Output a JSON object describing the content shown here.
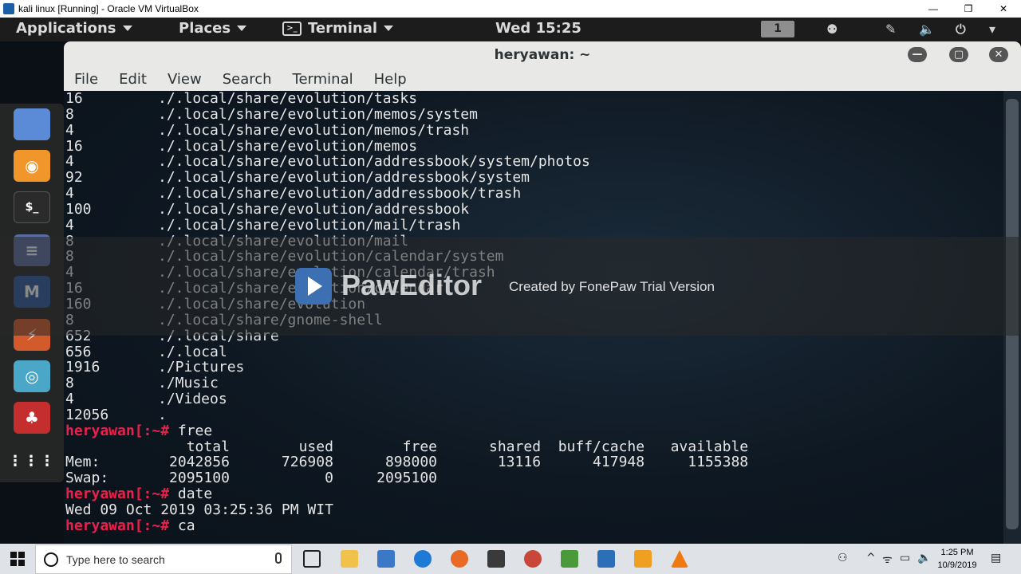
{
  "vbox": {
    "title": "kali linux [Running] - Oracle VM VirtualBox",
    "minimize": "—",
    "restore": "❐",
    "close": "✕"
  },
  "gnome": {
    "applications": "Applications",
    "places": "Places",
    "terminal": "Terminal",
    "clock": "Wed 15:25",
    "workspace": "1"
  },
  "dock": {
    "apps": [
      {
        "name": "files-icon",
        "color": "#5b8bd6",
        "glyph": "▭"
      },
      {
        "name": "burpsuite-icon",
        "color": "#f0962b",
        "glyph": "◉"
      },
      {
        "name": "terminal-app-icon",
        "color": "#2b2b2b",
        "glyph": "$_"
      },
      {
        "name": "text-editor-icon",
        "color": "#5a6ea0",
        "glyph": "≡"
      },
      {
        "name": "metasploit-icon",
        "color": "#2c5aa0",
        "glyph": "M"
      },
      {
        "name": "armitage-icon",
        "color": "#d35a2a",
        "glyph": "⚡"
      },
      {
        "name": "maltego-icon",
        "color": "#4aa7c8",
        "glyph": "◎"
      },
      {
        "name": "cherrytree-icon",
        "color": "#c42e2e",
        "glyph": "♣"
      },
      {
        "name": "show-apps-icon",
        "color": "transparent",
        "glyph": "⋮⋮⋮"
      }
    ]
  },
  "terminal": {
    "title": "heryawan: ~",
    "menu": [
      "File",
      "Edit",
      "View",
      "Search",
      "Terminal",
      "Help"
    ],
    "du_lines": [
      {
        "size": "16",
        "path": "./.local/share/evolution/tasks"
      },
      {
        "size": "8",
        "path": "./.local/share/evolution/memos/system"
      },
      {
        "size": "4",
        "path": "./.local/share/evolution/memos/trash"
      },
      {
        "size": "16",
        "path": "./.local/share/evolution/memos"
      },
      {
        "size": "4",
        "path": "./.local/share/evolution/addressbook/system/photos"
      },
      {
        "size": "92",
        "path": "./.local/share/evolution/addressbook/system"
      },
      {
        "size": "4",
        "path": "./.local/share/evolution/addressbook/trash"
      },
      {
        "size": "100",
        "path": "./.local/share/evolution/addressbook"
      },
      {
        "size": "4",
        "path": "./.local/share/evolution/mail/trash"
      },
      {
        "size": "8",
        "path": "./.local/share/evolution/mail"
      },
      {
        "size": "8",
        "path": "./.local/share/evolution/calendar/system"
      },
      {
        "size": "4",
        "path": "./.local/share/evolution/calendar/trash"
      },
      {
        "size": "16",
        "path": "./.local/share/evolution/calendar"
      },
      {
        "size": "160",
        "path": "./.local/share/evolution"
      },
      {
        "size": "8",
        "path": "./.local/share/gnome-shell"
      },
      {
        "size": "652",
        "path": "./.local/share"
      },
      {
        "size": "656",
        "path": "./.local"
      },
      {
        "size": "1916",
        "path": "./Pictures"
      },
      {
        "size": "8",
        "path": "./Music"
      },
      {
        "size": "4",
        "path": "./Videos"
      },
      {
        "size": "12056",
        "path": "."
      }
    ],
    "prompt": "heryawan[:~#",
    "cmd_free": " free",
    "free_header": "              total        used        free      shared  buff/cache   available",
    "free_mem": "Mem:        2042856      726908      898000       13116      417948     1155388",
    "free_swap": "Swap:       2095100           0     2095100",
    "cmd_date": " date",
    "date_output": "Wed 09 Oct 2019 03:25:36 PM WIT",
    "cmd_current": " ca"
  },
  "watermark": {
    "name": "PawEditor",
    "subtitle": "Created by FonePaw Trial Version"
  },
  "taskbar": {
    "search_placeholder": "Type here to search",
    "time": "1:25 PM",
    "date": "10/9/2019"
  }
}
